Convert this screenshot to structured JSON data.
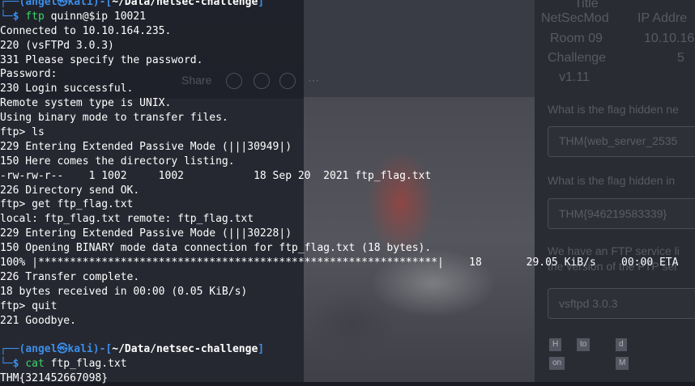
{
  "background_panel": {
    "col_title": "Title",
    "col_ip": "IP Addr",
    "rows": [
      {
        "title": "NetSecMod",
        "ip": "IP Addre"
      },
      {
        "title": "Room 09",
        "ip": "10.10.16"
      },
      {
        "title": "Challenge",
        "ip": "5"
      },
      {
        "title": "v1.11",
        "ip": ""
      }
    ],
    "share_label": "Share",
    "q1": "What is the flag hidden ne",
    "a1": "THM{web_server_2535",
    "q2": "What is the flag hidden in",
    "a2": "THM{946219583339}",
    "q3a": "We have an FTP service li",
    "q3b": "the version of the FTP ser",
    "a3": "vsftpd 3.0.3",
    "chips": [
      "H",
      "to",
      "d",
      "on",
      "M"
    ]
  },
  "terminal": {
    "prompt1": {
      "open": "┌──(",
      "user": "angel",
      "sep": "㉿",
      "host": "kali",
      "close": ")-[",
      "path": "~/Data/netsec-challenge",
      "end": "]"
    },
    "prompt_leader": "└─",
    "prompt_symbol": "$",
    "cmd_ftp": "ftp",
    "cmd_ftp_args": "quinn@$ip 10021",
    "output1": [
      "Connected to 10.10.164.235.",
      "220 (vsFTPd 3.0.3)",
      "331 Please specify the password.",
      "Password:",
      "230 Login successful.",
      "Remote system type is UNIX.",
      "Using binary mode to transfer files."
    ],
    "ftp_prompt": "ftp> ",
    "ftp_cmd_ls": "ls",
    "output2": [
      "229 Entering Extended Passive Mode (|||30949|)",
      "150 Here comes the directory listing.",
      "-rw-rw-r--    1 1002     1002           18 Sep 20  2021 ftp_flag.txt",
      "226 Directory send OK."
    ],
    "ftp_cmd_get": "get ftp_flag.txt",
    "output3": [
      "local: ftp_flag.txt remote: ftp_flag.txt",
      "229 Entering Extended Passive Mode (|||30228|)",
      "150 Opening BINARY mode data connection for ftp_flag.txt (18 bytes).",
      "100% |***************************************************************|    18       29.05 KiB/s    00:00 ETA",
      "226 Transfer complete.",
      "18 bytes received in 00:00 (0.05 KiB/s)"
    ],
    "ftp_cmd_quit": "quit",
    "goodbye": "221 Goodbye.",
    "prompt2": {
      "open": "┌──(",
      "user": "angel",
      "sep": "㉿",
      "host": "kali",
      "close": ")-[",
      "path": "~/Data/netsec-challenge",
      "end": "]"
    },
    "cmd_cat": "cat",
    "cmd_cat_args": "ftp_flag.txt",
    "flag_output": "THM{321452667098}"
  },
  "colors": {
    "prompt_frame": "#3b8eea",
    "command": "#3bd56b",
    "text": "#ffffff",
    "background": "#1a1b22"
  }
}
